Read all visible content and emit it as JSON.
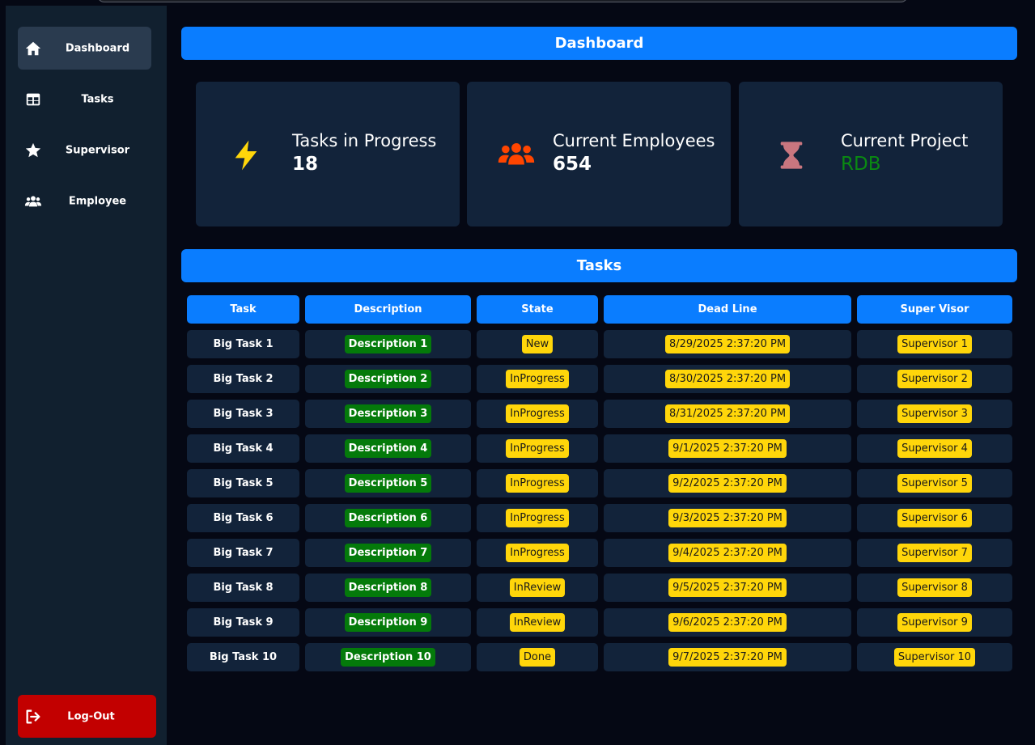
{
  "sidebar": {
    "items": [
      {
        "label": "Dashboard",
        "icon": "home-icon",
        "active": true
      },
      {
        "label": "Tasks",
        "icon": "table-icon",
        "active": false
      },
      {
        "label": "Supervisor",
        "icon": "star-icon",
        "active": false
      },
      {
        "label": "Employee",
        "icon": "users-icon",
        "active": false
      }
    ],
    "logout_label": "Log-Out"
  },
  "dashboard": {
    "title": "Dashboard",
    "cards": [
      {
        "title": "Tasks in Progress",
        "value": "18",
        "icon": "bolt-icon",
        "icon_color": "#ffd60a",
        "value_color": "#ffffff"
      },
      {
        "title": "Current Employees",
        "value": "654",
        "icon": "users-icon",
        "icon_color": "#ff4500",
        "value_color": "#ffffff"
      },
      {
        "title": "Current Project",
        "value": "RDB",
        "icon": "hourglass-icon",
        "icon_color": "#c9767f",
        "value_color": "#0a8a12"
      }
    ]
  },
  "tasks": {
    "title": "Tasks",
    "columns": [
      "Task",
      "Description",
      "State",
      "Dead Line",
      "Super Visor"
    ],
    "rows": [
      {
        "task": "Big Task 1",
        "description": "Description 1",
        "state": "New",
        "deadline": "8/29/2025 2:37:20 PM",
        "supervisor": "Supervisor 1"
      },
      {
        "task": "Big Task 2",
        "description": "Description 2",
        "state": "InProgress",
        "deadline": "8/30/2025 2:37:20 PM",
        "supervisor": "Supervisor 2"
      },
      {
        "task": "Big Task 3",
        "description": "Description 3",
        "state": "InProgress",
        "deadline": "8/31/2025 2:37:20 PM",
        "supervisor": "Supervisor 3"
      },
      {
        "task": "Big Task 4",
        "description": "Description 4",
        "state": "InProgress",
        "deadline": "9/1/2025 2:37:20 PM",
        "supervisor": "Supervisor 4"
      },
      {
        "task": "Big Task 5",
        "description": "Description 5",
        "state": "InProgress",
        "deadline": "9/2/2025 2:37:20 PM",
        "supervisor": "Supervisor 5"
      },
      {
        "task": "Big Task 6",
        "description": "Description 6",
        "state": "InProgress",
        "deadline": "9/3/2025 2:37:20 PM",
        "supervisor": "Supervisor 6"
      },
      {
        "task": "Big Task 7",
        "description": "Description 7",
        "state": "InProgress",
        "deadline": "9/4/2025 2:37:20 PM",
        "supervisor": "Supervisor 7"
      },
      {
        "task": "Big Task 8",
        "description": "Description 8",
        "state": "InReview",
        "deadline": "9/5/2025 2:37:20 PM",
        "supervisor": "Supervisor 8"
      },
      {
        "task": "Big Task 9",
        "description": "Description 9",
        "state": "InReview",
        "deadline": "9/6/2025 2:37:20 PM",
        "supervisor": "Supervisor 9"
      },
      {
        "task": "Big Task 10",
        "description": "Description 10",
        "state": "Done",
        "deadline": "9/7/2025 2:37:20 PM",
        "supervisor": "Supervisor 10"
      }
    ]
  },
  "colors": {
    "accent": "#0a7dff",
    "logout": "#c20000",
    "pill_green": "#047a0a",
    "pill_yellow": "#ffd60a"
  }
}
